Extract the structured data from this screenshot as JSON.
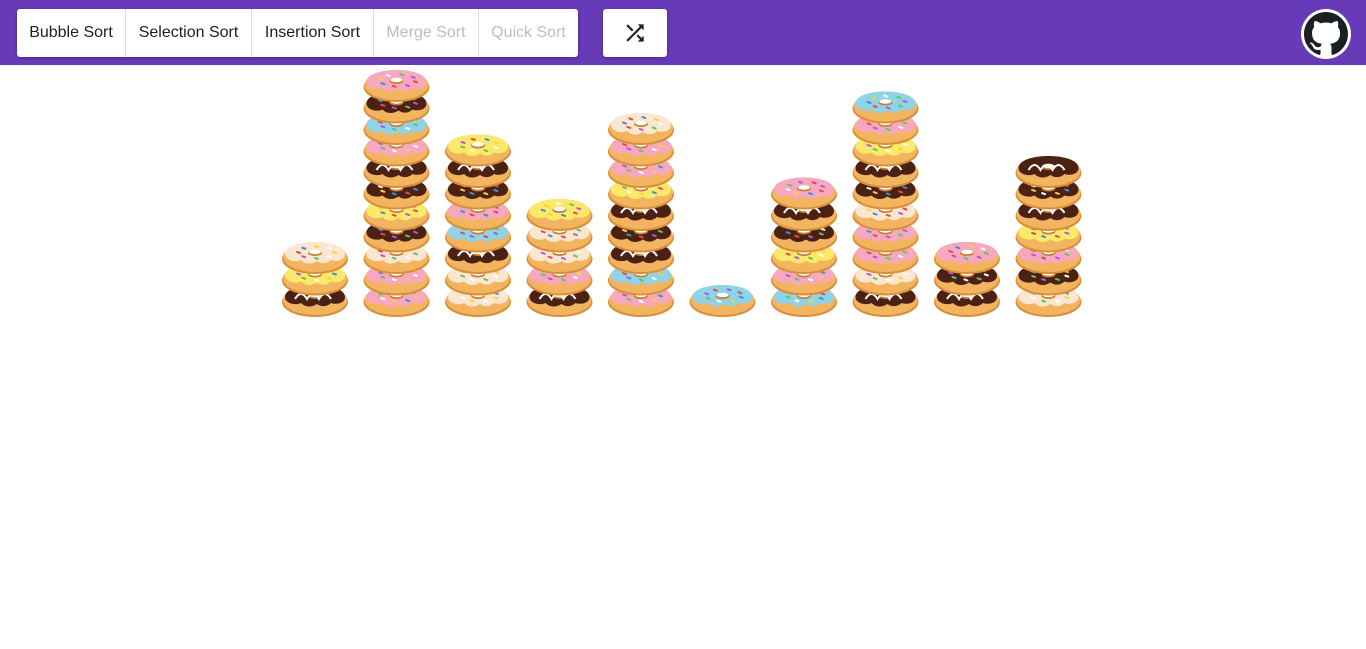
{
  "toolbar": {
    "buttons": [
      {
        "label": "Bubble Sort",
        "enabled": true
      },
      {
        "label": "Selection Sort",
        "enabled": true
      },
      {
        "label": "Insertion Sort",
        "enabled": true
      },
      {
        "label": "Merge Sort",
        "enabled": false
      },
      {
        "label": "Quick Sort",
        "enabled": false
      }
    ],
    "shuffle_icon": "shuffle-icon",
    "github_icon": "github-icon"
  },
  "colors": {
    "header": "#673ab7",
    "dough": "#f3b45f",
    "dough_dark": "#d88f3a"
  },
  "stacks": [
    {
      "count": 3,
      "glazes": [
        "chocolate",
        "yellow",
        "white"
      ]
    },
    {
      "count": 11,
      "glazes": [
        "pink",
        "pink",
        "white",
        "chocolate",
        "yellow",
        "chocolate",
        "chocolate",
        "pink",
        "blue",
        "chocolate",
        "pink"
      ]
    },
    {
      "count": 8,
      "glazes": [
        "white",
        "white",
        "chocolate",
        "blue",
        "pink",
        "chocolate",
        "chocolate",
        "yellow"
      ]
    },
    {
      "count": 5,
      "glazes": [
        "chocolate",
        "pink",
        "white",
        "white",
        "yellow"
      ]
    },
    {
      "count": 9,
      "glazes": [
        "pink",
        "blue",
        "chocolate",
        "chocolate",
        "chocolate",
        "yellow",
        "pink",
        "pink",
        "white"
      ]
    },
    {
      "count": 1,
      "glazes": [
        "blue"
      ]
    },
    {
      "count": 6,
      "glazes": [
        "blue",
        "pink",
        "yellow",
        "chocolate",
        "chocolate",
        "pink"
      ]
    },
    {
      "count": 10,
      "glazes": [
        "chocolate",
        "white",
        "pink",
        "pink",
        "white",
        "chocolate",
        "chocolate",
        "yellow",
        "pink",
        "blue"
      ]
    },
    {
      "count": 3,
      "glazes": [
        "chocolate",
        "chocolate",
        "pink"
      ]
    },
    {
      "count": 7,
      "glazes": [
        "white",
        "chocolate",
        "pink",
        "yellow",
        "chocolate",
        "chocolate",
        "chocolate"
      ]
    }
  ],
  "glaze_palette": {
    "pink": "#f7a8be",
    "blue": "#8fd3e6",
    "yellow": "#fbe96a",
    "white": "#fbe7cf",
    "chocolate": "#4a2113"
  }
}
